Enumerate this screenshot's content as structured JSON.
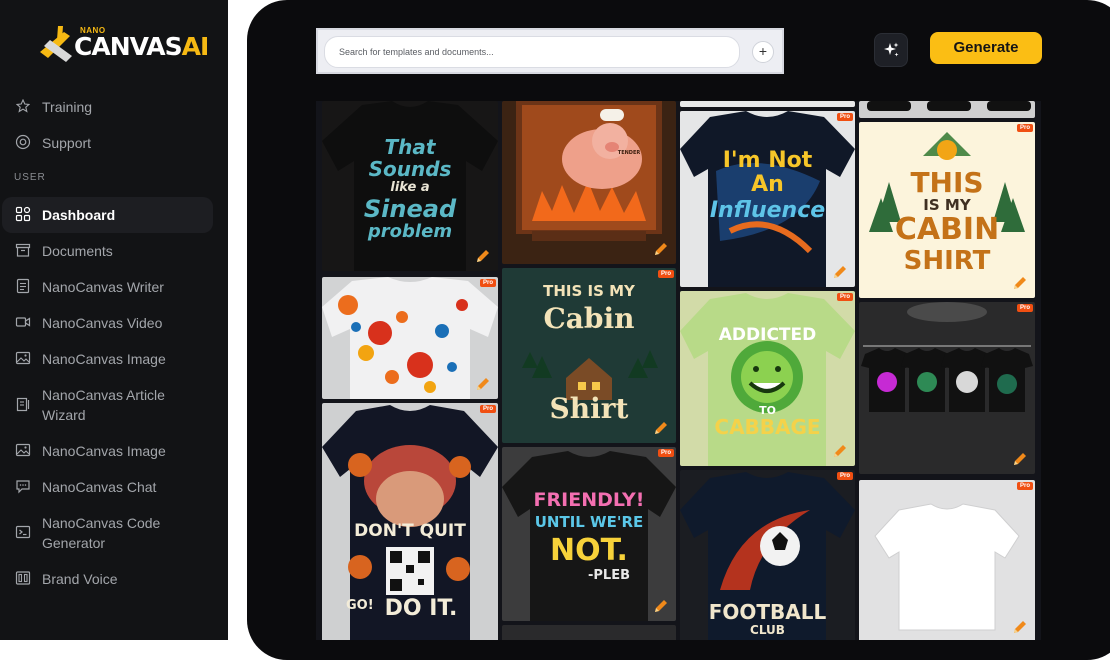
{
  "brand": {
    "small": "NANO",
    "main": "CANVAS",
    "accent": "AI",
    "color": "#f6b913"
  },
  "nav_top": [
    {
      "label": "Training",
      "icon": "star-icon"
    },
    {
      "label": "Support",
      "icon": "support-icon"
    }
  ],
  "section_label": "USER",
  "nav_user": [
    {
      "label": "Dashboard",
      "icon": "dashboard-icon",
      "active": true
    },
    {
      "label": "Documents",
      "icon": "documents-icon"
    },
    {
      "label": "NanoCanvas Writer",
      "icon": "writer-icon"
    },
    {
      "label": "NanoCanvas Video",
      "icon": "video-icon"
    },
    {
      "label": "NanoCanvas Image",
      "icon": "image-icon"
    },
    {
      "label": "NanoCanvas Article Wizard",
      "line1": "NanoCanvas Article",
      "line2": "Wizard",
      "icon": "article-icon"
    },
    {
      "label": "NanoCanvas Image",
      "icon": "image-icon"
    },
    {
      "label": "NanoCanvas Chat",
      "icon": "chat-icon"
    },
    {
      "label": "NanoCanvas Code Generator",
      "line1": "NanoCanvas Code",
      "line2": "Generator",
      "icon": "code-icon"
    },
    {
      "label": "Brand Voice",
      "icon": "brand-voice-icon"
    }
  ],
  "search": {
    "placeholder": "Search for templates and documents...",
    "plus": "+"
  },
  "generate_label": "Generate",
  "pro_badge": "Pro",
  "tiles": [
    {
      "t1": "That",
      "t2": "Sounds",
      "t3": "like a",
      "t4": "Sinead",
      "t5": "problem"
    },
    {
      "sub": "TENDER"
    },
    {
      "t1": "I'm Not",
      "t2": "An",
      "t3": "Influence"
    },
    {
      "t1": "THIS",
      "t2": "IS MY",
      "t3": "CABIN",
      "t4": "SHIRT"
    },
    {
      "t1": "THIS IS MY",
      "t2": "Cabin",
      "t3": "Shirt"
    },
    {
      "t1": "ADDICTED",
      "t2": "TO",
      "t3": "CABBAGE"
    },
    {
      "t1": "DON'T QUIT",
      "t2": "GO!",
      "t3": "DO IT."
    },
    {
      "t1": "FRIENDLY!",
      "t2": "UNTIL WE'RE",
      "t3": "NOT.",
      "t4": "-PLEB"
    },
    {
      "t1": "FOOTBALL",
      "t2": "CLUB"
    }
  ]
}
